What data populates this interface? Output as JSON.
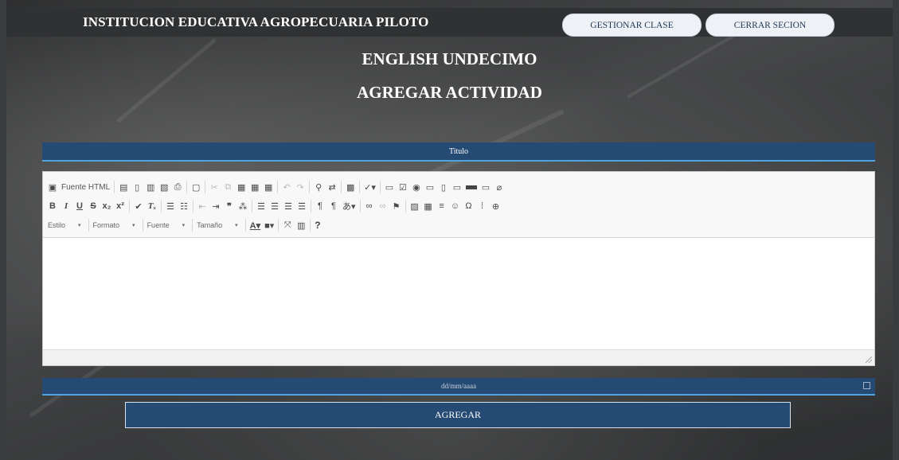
{
  "header": {
    "school_name": "INSTITUCION EDUCATIVA AGROPECUARIA PILOTO",
    "manage_button": "GESTIONAR CLASE",
    "logout_button": "CERRAR SECION"
  },
  "course_title": "ENGLISH UNDECIMO",
  "page_title": "AGREGAR ACTIVIDAD",
  "form": {
    "title_placeholder": "Titulo",
    "date_placeholder": "dd/mm/aaaa",
    "submit_label": "AGREGAR"
  },
  "editor": {
    "source_button": "Fuente HTML",
    "combos": {
      "style": "Estilo",
      "format": "Formato",
      "font": "Fuente",
      "size": "Tamaño"
    },
    "help_label": "?",
    "content": ""
  },
  "colors": {
    "accent": "#254a73",
    "accent_border": "#4fa3de",
    "button_bg": "#eef2f7"
  }
}
